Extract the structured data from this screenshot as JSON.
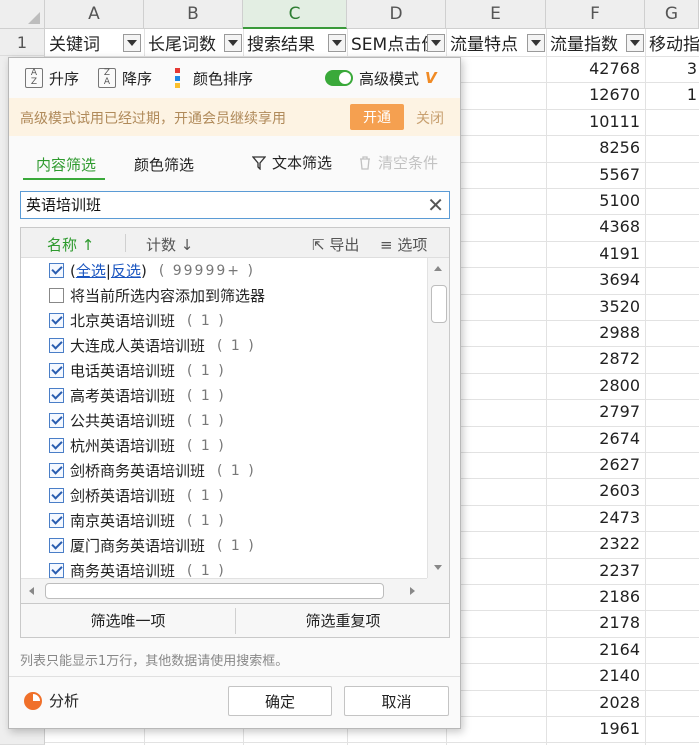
{
  "sheet": {
    "columns": [
      "A",
      "B",
      "C",
      "D",
      "E",
      "F",
      "G"
    ],
    "active_column": "C",
    "row_numbers": [
      "1"
    ],
    "headers": [
      "关键词",
      "长尾词数",
      "搜索结果",
      "SEM点击价",
      "流量特点",
      "流量指数",
      "移动指"
    ],
    "flow_index": [
      "42768",
      "12670",
      "10111",
      "8256",
      "5567",
      "5100",
      "4368",
      "4191",
      "3694",
      "3520",
      "2988",
      "2872",
      "2800",
      "2797",
      "2674",
      "2627",
      "2603",
      "2473",
      "2322",
      "2237",
      "2186",
      "2178",
      "2164",
      "2140",
      "2028",
      "1961"
    ],
    "mobile_partial": [
      "3",
      "1"
    ]
  },
  "panel": {
    "toolbar": {
      "asc": "升序",
      "desc": "降序",
      "color_sort": "颜色排序",
      "advanced": "高级模式",
      "vip_badge": "V"
    },
    "notice": {
      "text": "高级模式试用已经过期，开通会员继续享用",
      "open": "开通",
      "close": "关闭"
    },
    "tabs": {
      "content": "内容筛选",
      "color": "颜色筛选",
      "text_filter": "文本筛选",
      "clear": "清空条件"
    },
    "search": {
      "value": "英语培训班"
    },
    "list": {
      "name_col": "名称",
      "count_col": "计数",
      "export": "导出",
      "options": "选项",
      "select_all": "全选",
      "invert": "反选",
      "select_all_count": "( 99999+ )",
      "add_to_filter": "将当前所选内容添加到筛选器",
      "items": [
        {
          "label": "北京英语培训班",
          "count": "( 1 )"
        },
        {
          "label": "大连成人英语培训班",
          "count": "( 1 )"
        },
        {
          "label": "电话英语培训班",
          "count": "( 1 )"
        },
        {
          "label": "高考英语培训班",
          "count": "( 1 )"
        },
        {
          "label": "公共英语培训班",
          "count": "( 1 )"
        },
        {
          "label": "杭州英语培训班",
          "count": "( 1 )"
        },
        {
          "label": "剑桥商务英语培训班",
          "count": "( 1 )"
        },
        {
          "label": "剑桥英语培训班",
          "count": "( 1 )"
        },
        {
          "label": "南京英语培训班",
          "count": "( 1 )"
        },
        {
          "label": "厦门商务英语培训班",
          "count": "( 1 )"
        },
        {
          "label": "商务英语培训班",
          "count": "( 1 )"
        }
      ]
    },
    "unique": "筛选唯一项",
    "duplicate": "筛选重复项",
    "limit_note": "列表只能显示1万行，其他数据请使用搜索框。",
    "analysis": "分析",
    "ok": "确定",
    "cancel": "取消"
  },
  "colors": {
    "accent_green": "#3aa93a",
    "notice_orange": "#f5a050",
    "search_border": "#5b9bd5"
  }
}
